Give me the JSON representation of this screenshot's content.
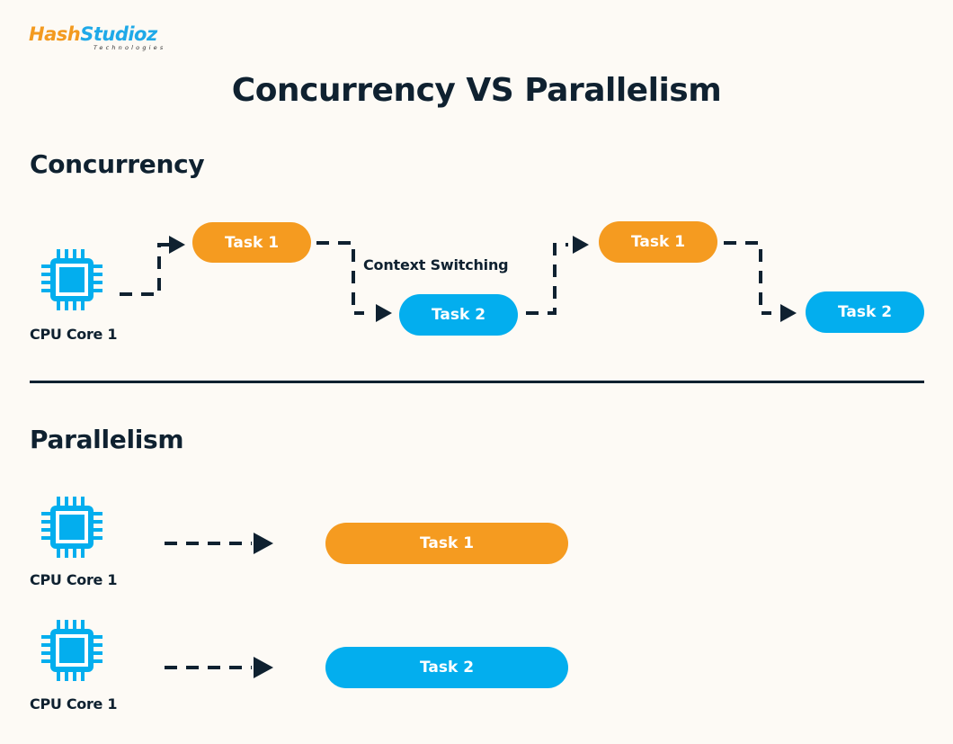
{
  "logo": {
    "brand_part1": "Hash",
    "brand_part2": "Studioz",
    "tagline": "Technologies"
  },
  "title": "Concurrency VS Parallelism",
  "colors": {
    "orange": "#f59b20",
    "blue": "#03aeee",
    "dark": "#0f2130",
    "background": "#fdfaf5"
  },
  "concurrency": {
    "heading": "Concurrency",
    "cpu": {
      "icon": "cpu-chip-icon",
      "label": "CPU Core 1"
    },
    "tasks": [
      {
        "label": "Task 1",
        "color": "orange"
      },
      {
        "label": "Task 2",
        "color": "blue"
      },
      {
        "label": "Task 1",
        "color": "orange"
      },
      {
        "label": "Task 2",
        "color": "blue"
      }
    ],
    "annotation": "Context Switching"
  },
  "parallelism": {
    "heading": "Parallelism",
    "rows": [
      {
        "cpu_icon": "cpu-chip-icon",
        "cpu_label": "CPU Core 1",
        "task": "Task 1",
        "color": "orange"
      },
      {
        "cpu_icon": "cpu-chip-icon",
        "cpu_label": "CPU Core 1",
        "task": "Task 2",
        "color": "blue"
      }
    ]
  }
}
